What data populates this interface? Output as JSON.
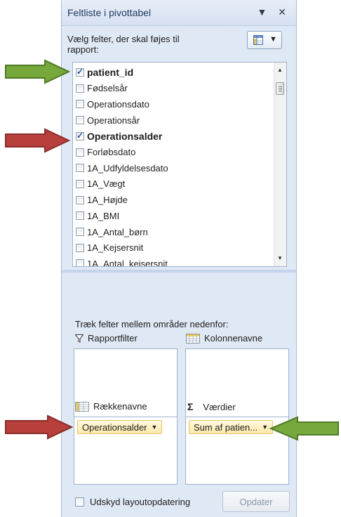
{
  "panel": {
    "title": "Feltliste i pivottabel",
    "title_controls": "▼ ✕",
    "prompt": "Vælg felter, der skal føjes til rapport:",
    "layout_button_arrow": "▼"
  },
  "fields": [
    {
      "label": "patient_id",
      "checked": true
    },
    {
      "label": "Fødselsår",
      "checked": false
    },
    {
      "label": "Operationsdato",
      "checked": false
    },
    {
      "label": "Operationsår",
      "checked": false
    },
    {
      "label": "Operationsalder",
      "checked": true
    },
    {
      "label": "Forløbsdato",
      "checked": false
    },
    {
      "label": "1A_Udfyldelsesdato",
      "checked": false
    },
    {
      "label": "1A_Vægt",
      "checked": false
    },
    {
      "label": "1A_Højde",
      "checked": false
    },
    {
      "label": "1A_BMI",
      "checked": false
    },
    {
      "label": "1A_Antal_børn",
      "checked": false
    },
    {
      "label": "1A_Kejsersnit",
      "checked": false
    },
    {
      "label": "1A_Antal_kejsersnit",
      "checked": false
    }
  ],
  "areas": {
    "drag_prompt": "Træk felter mellem områder nedenfor:",
    "report_filter": "Rapportfilter",
    "column_labels": "Kolonnenavne",
    "row_labels": "Rækkenavne",
    "values": "Værdier",
    "sigma": "Σ",
    "row_pill": "Operationsalder",
    "values_pill": "Sum af patien...",
    "pill_arrow": "▼"
  },
  "footer": {
    "defer_label": "Udskyd layoutopdatering",
    "update_button": "Opdater"
  },
  "colors": {
    "green_arrow": "#77a83b",
    "red_arrow": "#b8403c"
  }
}
